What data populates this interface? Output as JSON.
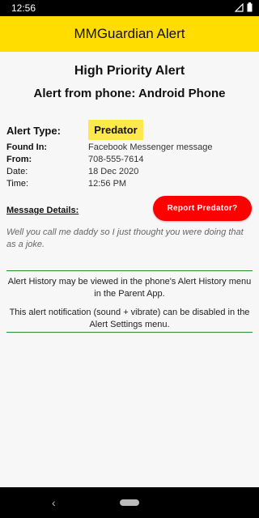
{
  "status_bar": {
    "time": "12:56"
  },
  "app_bar": {
    "title": "MMGuardian Alert"
  },
  "alert": {
    "priority_title": "High Priority Alert",
    "phone_title": "Alert from phone: Android Phone",
    "type_label": "Alert Type:",
    "type_value": "Predator",
    "rows": [
      {
        "label": "Found In:",
        "value": "Facebook Messenger message"
      },
      {
        "label": "From:",
        "value": "708-555-7614"
      },
      {
        "label": "Date:",
        "value": "18 Dec 2020"
      },
      {
        "label": "Time:",
        "value": "12:56 PM"
      }
    ],
    "message_label": "Message Details:",
    "report_button": "Report Predator?",
    "message_text": "Well you call me daddy so I just thought you were doing that as a joke."
  },
  "info": {
    "history_text": "Alert History may be viewed in the phone's Alert History menu in the Parent App.",
    "settings_text": "This alert notification (sound + vibrate) can be disabled in the Alert Settings menu."
  },
  "colors": {
    "app_bar": "#ffdd00",
    "badge": "#ffe84a",
    "report_button": "#ff0000",
    "divider": "#2e8b2e"
  }
}
